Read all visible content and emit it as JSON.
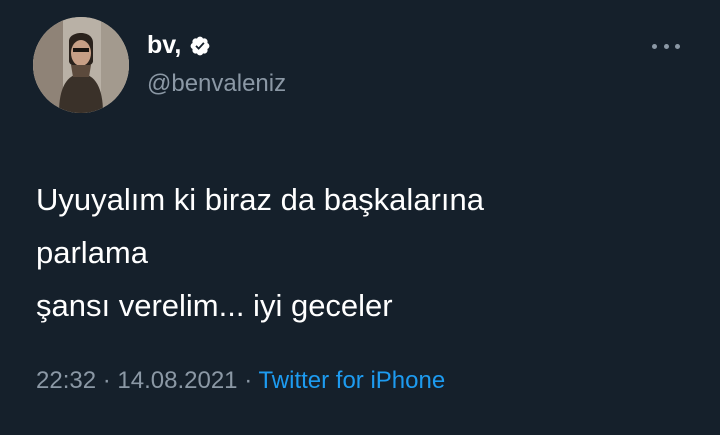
{
  "user": {
    "display_name": "bv,",
    "handle": "@benvaleniz",
    "verified": true
  },
  "tweet": {
    "lines": [
      "Uyuyalım ki biraz da başkalarına",
      "parlama",
      "şansı verelim... iyi geceler"
    ],
    "time": "22:32",
    "separator1": "·",
    "date": "14.08.2021",
    "separator2": "·",
    "source": "Twitter for iPhone"
  },
  "icons": {
    "verified": "verified-badge-icon",
    "more": "more-horizontal-icon"
  },
  "colors": {
    "background": "#15202b",
    "text": "#ffffff",
    "secondary_text": "#8b98a5",
    "link": "#1d9bf0"
  }
}
